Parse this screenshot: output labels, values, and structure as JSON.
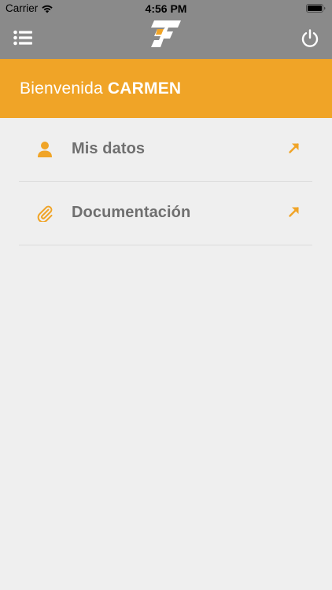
{
  "status_bar": {
    "carrier": "Carrier",
    "time": "4:56 PM"
  },
  "nav": {
    "menu_icon": "list-menu-icon",
    "logo_icon": "company-logo",
    "power_icon": "power-icon"
  },
  "welcome": {
    "greeting": "Bienvenida",
    "name": "CARMEN"
  },
  "menu": {
    "items": [
      {
        "label": "Mis datos",
        "icon": "user-icon",
        "action_icon": "arrow-up-right-icon"
      },
      {
        "label": "Documentación",
        "icon": "paperclip-icon",
        "action_icon": "arrow-up-right-icon"
      }
    ]
  },
  "colors": {
    "header_gray": "#8a8a8a",
    "accent_orange": "#f0a427",
    "background": "#efefef",
    "label_gray": "#6f6f6f"
  }
}
